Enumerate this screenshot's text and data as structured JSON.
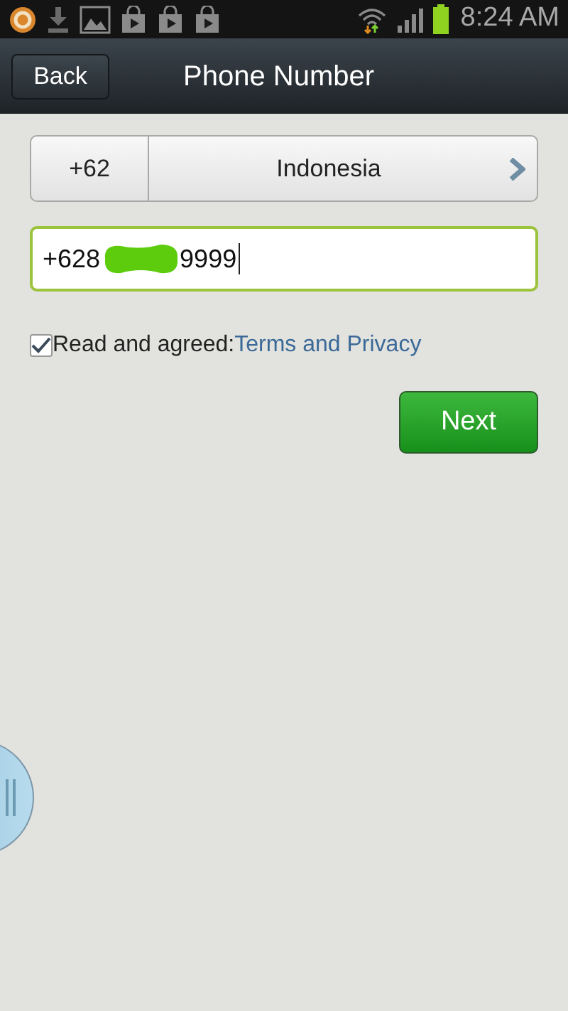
{
  "status_bar": {
    "time": "8:24 AM",
    "battery": {
      "level": 1
    }
  },
  "title_bar": {
    "back": "Back",
    "title": "Phone Number"
  },
  "country": {
    "code": "+62",
    "name": "Indonesia"
  },
  "phone_field": {
    "value_start": "+628",
    "value_end": "9999",
    "redacted": true,
    "focused": true
  },
  "agreement": {
    "checked": true,
    "label": "Read and agreed:",
    "link": "Terms and Privacy"
  },
  "next_button": "Next"
}
